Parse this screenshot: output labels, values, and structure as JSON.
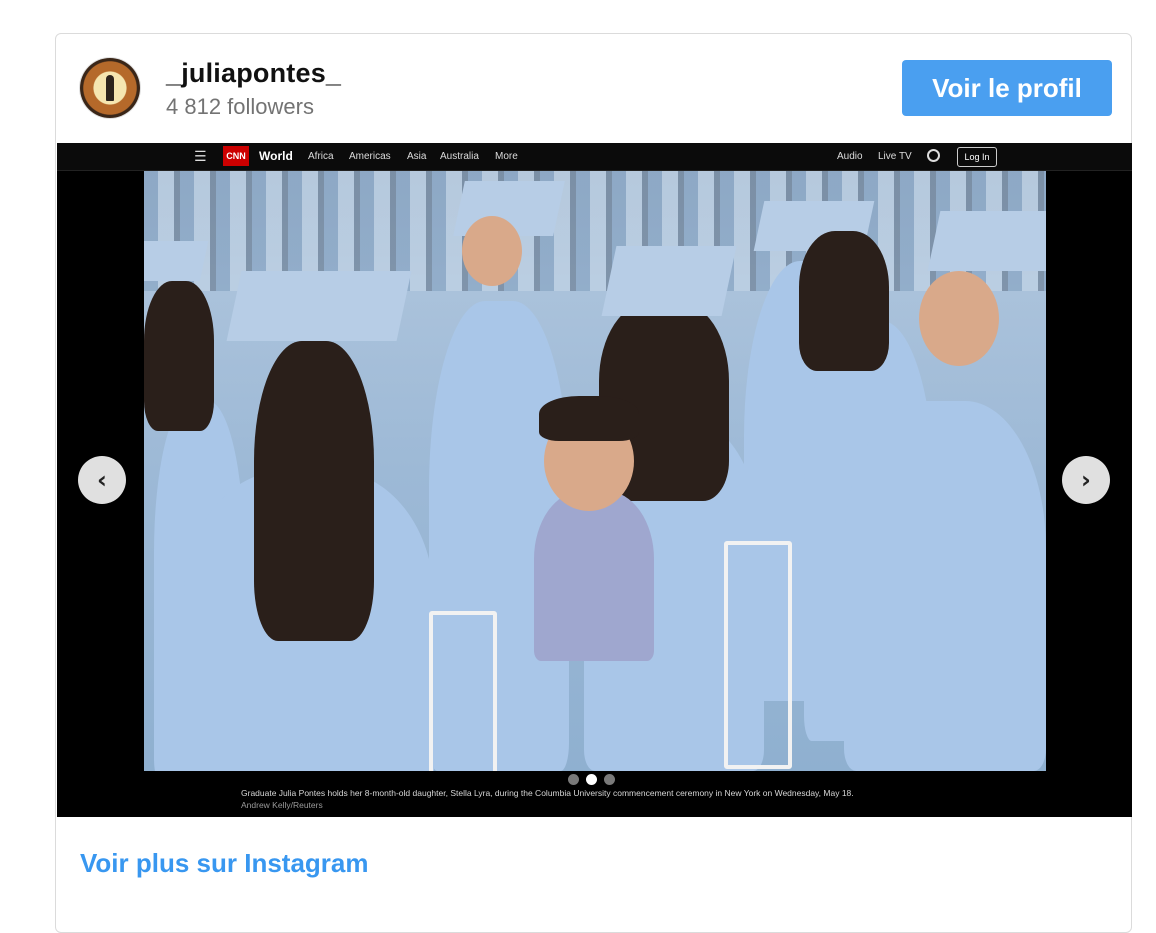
{
  "header": {
    "username": "_juliapontes_",
    "followers": "4 812 followers",
    "profile_button": "Voir le profil"
  },
  "media": {
    "cnn_nav": {
      "menu_glyph": "☰",
      "logo": "CNN",
      "section": "World",
      "links": [
        "Africa",
        "Americas",
        "Asia",
        "Australia",
        "More"
      ],
      "right_links": [
        "Audio",
        "Live TV"
      ],
      "login": "Log In"
    },
    "caption": "Graduate Julia Pontes holds her 8-month-old daughter, Stella Lyra, during the Columbia University commencement ceremony in New York on Wednesday, May 18.",
    "credit": "Andrew Kelly/Reuters",
    "carousel": {
      "prev": "‹",
      "next": "›",
      "active_index": 1,
      "total": 3
    }
  },
  "footer": {
    "more_link": "Voir plus sur Instagram"
  },
  "colors": {
    "accent": "#4a9ff0",
    "link": "#3897f0",
    "gown": "#a9c6e8"
  }
}
